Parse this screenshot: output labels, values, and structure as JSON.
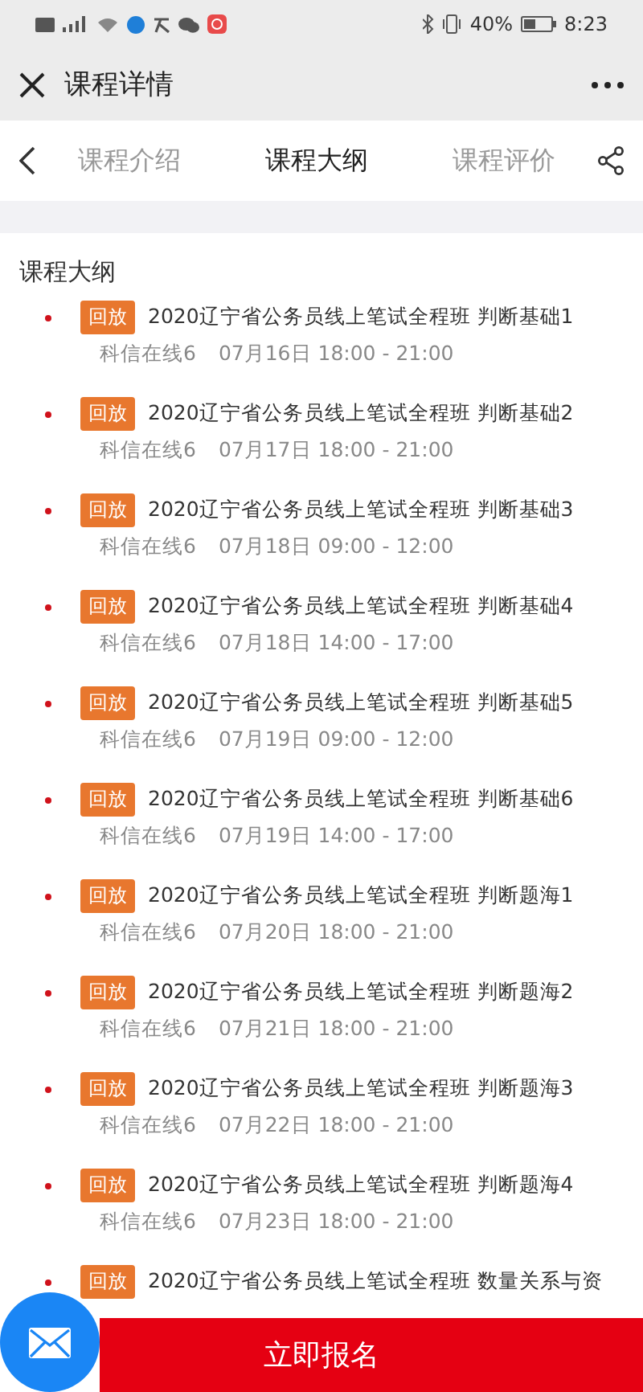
{
  "status_bar": {
    "battery_text": "40%",
    "time": "8:23"
  },
  "header": {
    "title": "课程详情"
  },
  "tabs": [
    {
      "label": "课程介绍",
      "selected": false
    },
    {
      "label": "课程大纲",
      "selected": true
    },
    {
      "label": "课程评价",
      "selected": false
    }
  ],
  "section_title": "课程大纲",
  "lessons": [
    {
      "tag": "回放",
      "title": "2020辽宁省公务员线上笔试全程班 判断基础1",
      "teacher": "科信在线6",
      "time": "07月16日 18:00 - 21:00"
    },
    {
      "tag": "回放",
      "title": "2020辽宁省公务员线上笔试全程班 判断基础2",
      "teacher": "科信在线6",
      "time": "07月17日 18:00 - 21:00"
    },
    {
      "tag": "回放",
      "title": "2020辽宁省公务员线上笔试全程班 判断基础3",
      "teacher": "科信在线6",
      "time": "07月18日 09:00 - 12:00"
    },
    {
      "tag": "回放",
      "title": "2020辽宁省公务员线上笔试全程班 判断基础4",
      "teacher": "科信在线6",
      "time": "07月18日 14:00 - 17:00"
    },
    {
      "tag": "回放",
      "title": "2020辽宁省公务员线上笔试全程班 判断基础5",
      "teacher": "科信在线6",
      "time": "07月19日 09:00 - 12:00"
    },
    {
      "tag": "回放",
      "title": "2020辽宁省公务员线上笔试全程班 判断基础6",
      "teacher": "科信在线6",
      "time": "07月19日 14:00 - 17:00"
    },
    {
      "tag": "回放",
      "title": "2020辽宁省公务员线上笔试全程班 判断题海1",
      "teacher": "科信在线6",
      "time": "07月20日 18:00 - 21:00"
    },
    {
      "tag": "回放",
      "title": "2020辽宁省公务员线上笔试全程班 判断题海2",
      "teacher": "科信在线6",
      "time": "07月21日 18:00 - 21:00"
    },
    {
      "tag": "回放",
      "title": "2020辽宁省公务员线上笔试全程班 判断题海3",
      "teacher": "科信在线6",
      "time": "07月22日 18:00 - 21:00"
    },
    {
      "tag": "回放",
      "title": "2020辽宁省公务员线上笔试全程班 判断题海4",
      "teacher": "科信在线6",
      "time": "07月23日 18:00 - 21:00"
    },
    {
      "tag": "回放",
      "title": "2020辽宁省公务员线上笔试全程班 数量关系与资"
    }
  ],
  "signup_button": "立即报名"
}
